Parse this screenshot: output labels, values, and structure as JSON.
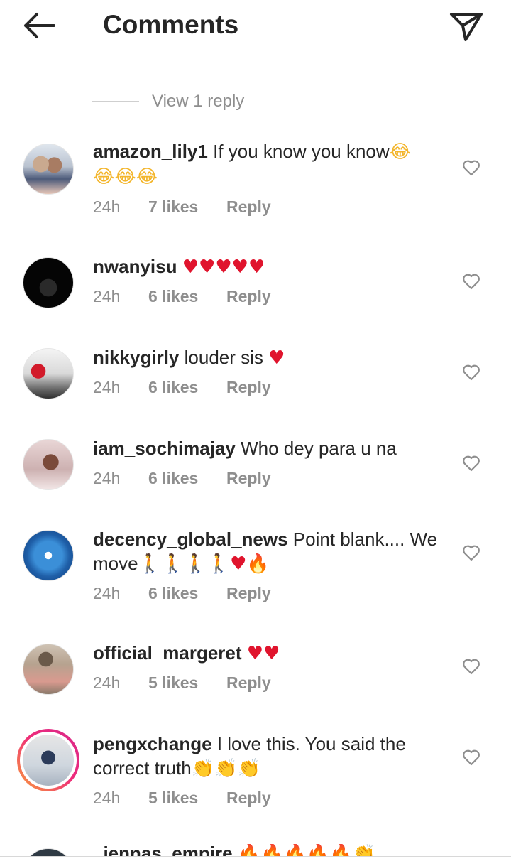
{
  "header": {
    "title": "Comments"
  },
  "view_replies": "View 1 reply",
  "comments": [
    {
      "username": "amazon_lily1",
      "text": "If you know you know",
      "emoji": "😂",
      "emoji2": "😂😂😂",
      "time": "24h",
      "likes": "7 likes",
      "reply": "Reply"
    },
    {
      "username": "nwanyisu",
      "text": "",
      "emoji": "♥♥♥♥♥",
      "time": "24h",
      "likes": "6 likes",
      "reply": "Reply"
    },
    {
      "username": "nikkygirly",
      "text": "louder sis",
      "emoji": "♥",
      "time": "24h",
      "likes": "6 likes",
      "reply": "Reply"
    },
    {
      "username": "iam_sochimajay",
      "text": "Who dey para u na",
      "time": "24h",
      "likes": "6 likes",
      "reply": "Reply"
    },
    {
      "username": "decency_global_news",
      "text": "Point blank.... We move",
      "emoji": "🚶🚶🚶🚶",
      "emoji2": "♥",
      "emoji3": "🔥",
      "time": "24h",
      "likes": "6 likes",
      "reply": "Reply"
    },
    {
      "username": "official_margeret",
      "text": "",
      "emoji": "♥♥",
      "time": "24h",
      "likes": "5 likes",
      "reply": "Reply"
    },
    {
      "username": "pengxchange",
      "text": "I love this. You said the correct truth",
      "emoji": "👏👏👏",
      "time": "24h",
      "likes": "5 likes",
      "reply": "Reply"
    },
    {
      "username": "_jennas_empire",
      "text": "",
      "emoji": "🔥🔥🔥🔥🔥👏"
    }
  ],
  "colors": {
    "heart_red": "#e0142d",
    "story_ring": "#ee2a7b",
    "muted": "#8e8e8e"
  }
}
